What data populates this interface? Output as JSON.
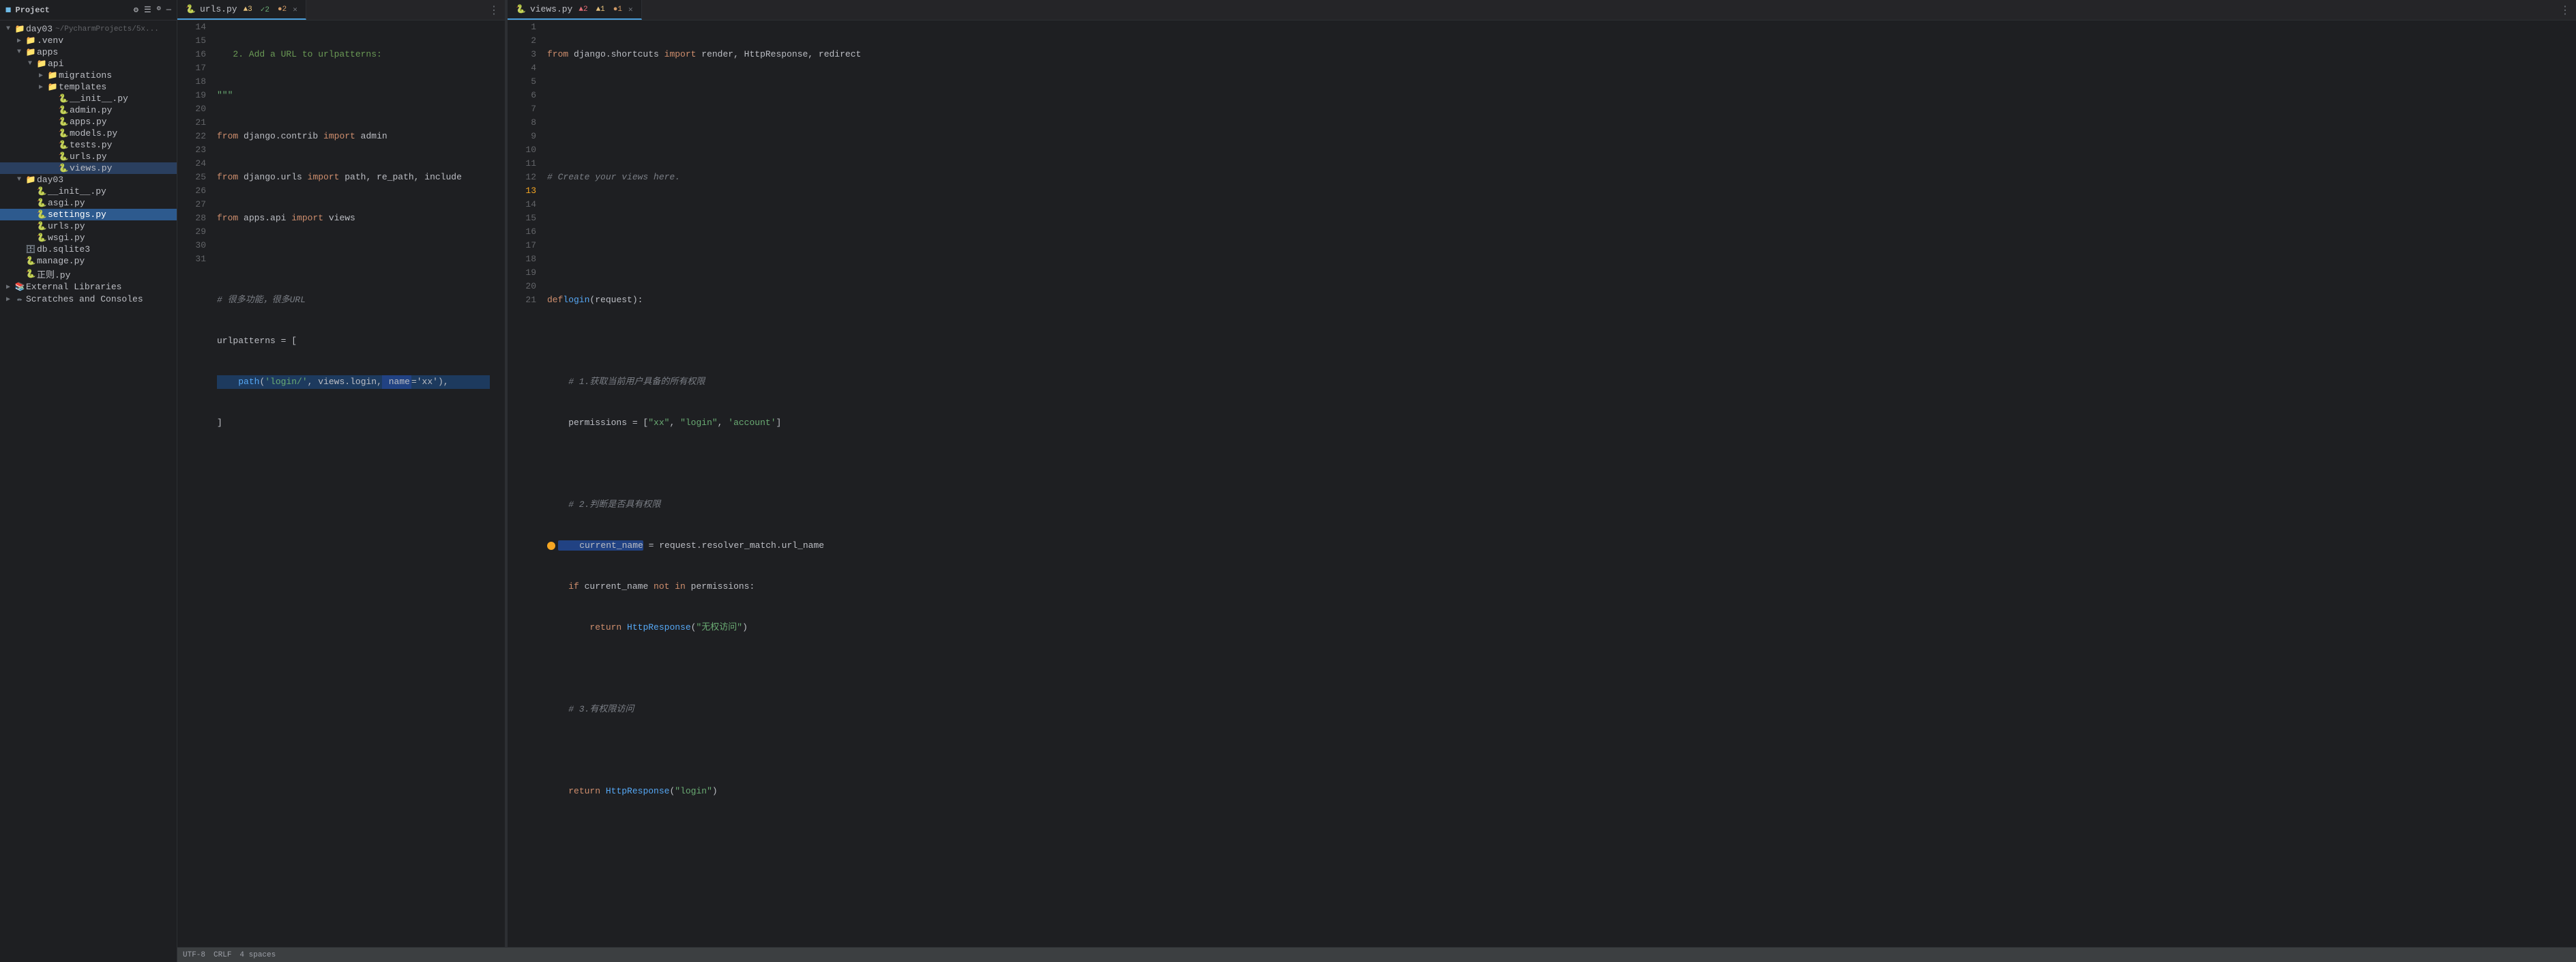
{
  "sidebar": {
    "header": {
      "title": "Project",
      "icons": [
        "settings-icon",
        "list-icon",
        "gear-icon",
        "minus-icon"
      ]
    },
    "tree": [
      {
        "id": "day03",
        "label": "day03",
        "type": "folder",
        "indent": 0,
        "expanded": true,
        "prefix": "~/PycharmProjects/5x..."
      },
      {
        "id": "venv",
        "label": ".venv",
        "type": "folder",
        "indent": 1,
        "expanded": false
      },
      {
        "id": "apps",
        "label": "apps",
        "type": "folder",
        "indent": 1,
        "expanded": true
      },
      {
        "id": "api",
        "label": "api",
        "type": "folder",
        "indent": 2,
        "expanded": true
      },
      {
        "id": "migrations",
        "label": "migrations",
        "type": "folder",
        "indent": 3,
        "expanded": false
      },
      {
        "id": "templates",
        "label": "templates",
        "type": "folder",
        "indent": 3,
        "expanded": false
      },
      {
        "id": "__init__py",
        "label": "__init__.py",
        "type": "py",
        "indent": 3
      },
      {
        "id": "admin_py",
        "label": "admin.py",
        "type": "py",
        "indent": 3
      },
      {
        "id": "apps_py",
        "label": "apps.py",
        "type": "py",
        "indent": 3
      },
      {
        "id": "models_py",
        "label": "models.py",
        "type": "py",
        "indent": 3
      },
      {
        "id": "tests_py",
        "label": "tests.py",
        "type": "py",
        "indent": 3
      },
      {
        "id": "urls_py_inner",
        "label": "urls.py",
        "type": "py",
        "indent": 3
      },
      {
        "id": "views_py_inner",
        "label": "views.py",
        "type": "py",
        "indent": 3,
        "active": true
      },
      {
        "id": "day03_folder",
        "label": "day03",
        "type": "folder",
        "indent": 1,
        "expanded": true
      },
      {
        "id": "__init__day03",
        "label": "__init__.py",
        "type": "py",
        "indent": 2
      },
      {
        "id": "asgi_py",
        "label": "asgi.py",
        "type": "py",
        "indent": 2
      },
      {
        "id": "settings_py",
        "label": "settings.py",
        "type": "py",
        "indent": 2,
        "selected": true
      },
      {
        "id": "urls_py_outer",
        "label": "urls.py",
        "type": "py",
        "indent": 2
      },
      {
        "id": "wsgi_py",
        "label": "wsgi.py",
        "type": "py",
        "indent": 2
      },
      {
        "id": "db_sqlite3",
        "label": "db.sqlite3",
        "type": "file",
        "indent": 1
      },
      {
        "id": "manage_py",
        "label": "manage.py",
        "type": "py",
        "indent": 1
      },
      {
        "id": "zhengze_py",
        "label": "正则.py",
        "type": "py",
        "indent": 1
      },
      {
        "id": "external_libs",
        "label": "External Libraries",
        "type": "lib",
        "indent": 0,
        "expanded": false
      },
      {
        "id": "scratches",
        "label": "Scratches and Consoles",
        "type": "scratches",
        "indent": 0,
        "expanded": false
      }
    ]
  },
  "editor_left": {
    "tab": {
      "filename": "urls.py",
      "warnings": {
        "yellow": 3,
        "green": 2,
        "orange": 2
      }
    },
    "lines": [
      {
        "num": 14,
        "code": "   2. Add a URL to urlpatterns:",
        "type": "comment"
      },
      {
        "num": 15,
        "code": "\"\"\"",
        "type": "string"
      },
      {
        "num": 16,
        "code": "from django.contrib import admin",
        "type": "code"
      },
      {
        "num": 17,
        "code": "from django.urls import path, re_path, include",
        "type": "code"
      },
      {
        "num": 18,
        "code": "from apps.api import views",
        "type": "code"
      },
      {
        "num": 19,
        "code": "",
        "type": "empty"
      },
      {
        "num": 20,
        "code": "# 很多功能，很多URL",
        "type": "comment"
      },
      {
        "num": 21,
        "code": "urlpatterns = [",
        "type": "code"
      },
      {
        "num": 22,
        "code": "    path('login/', views.login, name='xx'),",
        "type": "code",
        "highlighted": true
      },
      {
        "num": 23,
        "code": "]",
        "type": "code"
      },
      {
        "num": 24,
        "code": "",
        "type": "empty"
      },
      {
        "num": 25,
        "code": "",
        "type": "empty"
      },
      {
        "num": 26,
        "code": "",
        "type": "empty"
      },
      {
        "num": 27,
        "code": "",
        "type": "empty"
      },
      {
        "num": 28,
        "code": "",
        "type": "empty"
      },
      {
        "num": 29,
        "code": "",
        "type": "empty"
      },
      {
        "num": 30,
        "code": "",
        "type": "empty"
      },
      {
        "num": 31,
        "code": "",
        "type": "empty"
      }
    ]
  },
  "editor_right": {
    "tab": {
      "filename": "views.py",
      "warnings": {
        "red": 2,
        "yellow": 1,
        "orange": 1
      }
    },
    "lines": [
      {
        "num": 1,
        "code": "from django.shortcuts import render, HttpResponse, redirect",
        "type": "code"
      },
      {
        "num": 2,
        "code": "",
        "type": "empty"
      },
      {
        "num": 3,
        "code": "",
        "type": "empty"
      },
      {
        "num": 4,
        "code": "# Create your views here.",
        "type": "comment"
      },
      {
        "num": 5,
        "code": "",
        "type": "empty"
      },
      {
        "num": 6,
        "code": "",
        "type": "empty"
      },
      {
        "num": 7,
        "code": "def login(request):",
        "type": "code"
      },
      {
        "num": 8,
        "code": "",
        "type": "empty"
      },
      {
        "num": 9,
        "code": "    # 1.获取当前用户具备的所有权限",
        "type": "comment"
      },
      {
        "num": 10,
        "code": "    permissions = [\"xx\", \"login\", 'account']",
        "type": "code"
      },
      {
        "num": 11,
        "code": "",
        "type": "empty"
      },
      {
        "num": 12,
        "code": "    # 2.判断是否具有权限",
        "type": "comment"
      },
      {
        "num": 13,
        "code": "    current_name = request.resolver_match.url_name",
        "type": "code",
        "breakpoint": true
      },
      {
        "num": 14,
        "code": "    if current_name not in permissions:",
        "type": "code"
      },
      {
        "num": 15,
        "code": "        return HttpResponse(\"无权访问\")",
        "type": "code"
      },
      {
        "num": 16,
        "code": "",
        "type": "empty"
      },
      {
        "num": 17,
        "code": "    # 3.有权限访问",
        "type": "comment"
      },
      {
        "num": 18,
        "code": "",
        "type": "empty"
      },
      {
        "num": 19,
        "code": "    return HttpResponse(\"login\")",
        "type": "code"
      },
      {
        "num": 20,
        "code": "",
        "type": "empty"
      },
      {
        "num": 21,
        "code": "",
        "type": "empty"
      }
    ]
  },
  "status_bar": {
    "encoding": "UTF-8",
    "line_col": "CRLF",
    "indentation": "4 spaces"
  }
}
